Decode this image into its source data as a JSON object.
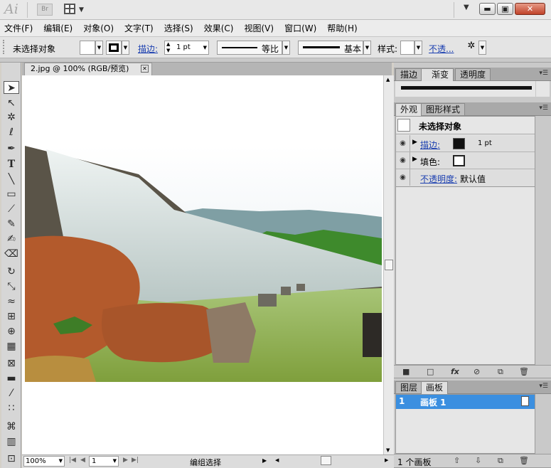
{
  "app": {
    "logo": "Ai",
    "bridge_label": "Br"
  },
  "menu": {
    "items": [
      "文件(F)",
      "编辑(E)",
      "对象(O)",
      "文字(T)",
      "选择(S)",
      "效果(C)",
      "视图(V)",
      "窗口(W)",
      "帮助(H)"
    ]
  },
  "control": {
    "selection_label": "未选择对象",
    "stroke_label": "描边:",
    "stroke_weight": "1 pt",
    "profile_label": "等比",
    "brush_label": "基本",
    "style_label": "样式:",
    "opacity_label": "不透..."
  },
  "document": {
    "tab_title": "2.jpg @ 100% (RGB/预览)",
    "close_glyph": "✕",
    "zoom": "100%",
    "artboard_number": "1",
    "status_text": "编组选择"
  },
  "panels": {
    "stroke_tabs": [
      "描边",
      "渐变",
      "透明度"
    ],
    "appearance_tabs": [
      "外观",
      "图形样式"
    ],
    "appearance_title": "未选择对象",
    "appearance_rows": [
      {
        "label": "描边:",
        "value": "1 pt"
      },
      {
        "label": "填色:",
        "value": ""
      },
      {
        "label": "不透明度:",
        "value": "默认值"
      }
    ],
    "layers_tabs": [
      "图层",
      "画板"
    ],
    "artboard_item": {
      "number": "1",
      "name": "画板 1"
    },
    "artboard_count": "1 个画板"
  },
  "colors": {
    "accent": "#3b8fe0",
    "link": "#1b3fb0"
  }
}
